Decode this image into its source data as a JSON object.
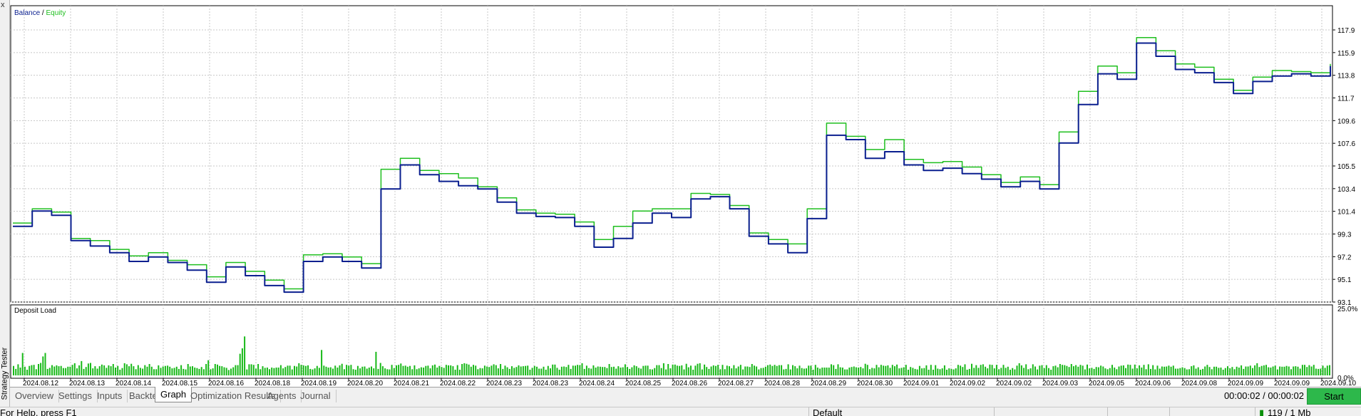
{
  "sidebar": {
    "close_glyph": "x",
    "title": "Strategy Tester"
  },
  "tabs": [
    {
      "label": "Overview",
      "active": false
    },
    {
      "label": "Settings",
      "active": false
    },
    {
      "label": "Inputs",
      "active": false
    },
    {
      "label": "Backtest",
      "active": false
    },
    {
      "label": "Graph",
      "active": true
    },
    {
      "label": "Optimization Results",
      "active": false
    },
    {
      "label": "Agents",
      "active": false
    },
    {
      "label": "Journal",
      "active": false
    }
  ],
  "timer": "00:00:02 / 00:00:02",
  "start_label": "Start",
  "status": {
    "help": "For Help, press F1",
    "profile": "Default",
    "traffic": "119 / 1 Mb"
  },
  "colors": {
    "balance": "#0a1f8f",
    "equity": "#1fbf1f",
    "deposit_bar": "#18b918",
    "grid": "#c8c8c8",
    "start_button": "#2db84b"
  },
  "chart_data": [
    {
      "type": "line",
      "legend": {
        "balance": "Balance",
        "separator": " / ",
        "equity": "Equity"
      },
      "legend_position": "top-left",
      "ylim": [
        93.1,
        117.9
      ],
      "ytick_labels": [
        "117.9",
        "115.9",
        "113.8",
        "111.7",
        "109.6",
        "107.6",
        "105.5",
        "103.4",
        "101.4",
        "99.3",
        "97.2",
        "95.1",
        "93.1"
      ],
      "grid": true,
      "series": [
        {
          "name": "Balance",
          "values": [
            100.0,
            101.4,
            101.0,
            98.7,
            98.2,
            97.6,
            96.8,
            97.2,
            96.7,
            96.0,
            94.9,
            96.3,
            95.5,
            94.6,
            94.0,
            96.8,
            97.2,
            96.8,
            96.2,
            103.4,
            105.6,
            104.7,
            104.1,
            103.7,
            103.4,
            102.2,
            101.2,
            100.9,
            100.8,
            100.0,
            98.1,
            98.9,
            100.3,
            101.2,
            100.8,
            102.5,
            102.7,
            101.6,
            99.1,
            98.4,
            97.6,
            100.7,
            108.3,
            107.9,
            106.2,
            106.8,
            105.6,
            105.1,
            105.3,
            104.8,
            104.3,
            103.6,
            104.1,
            103.4,
            107.6,
            111.1,
            113.9,
            113.4,
            116.7,
            115.5,
            114.3,
            114.0,
            113.1,
            112.1,
            113.2,
            113.7,
            113.9,
            113.7,
            114.6
          ]
        },
        {
          "name": "Equity",
          "values": [
            100.3,
            101.6,
            101.3,
            98.9,
            98.7,
            97.9,
            97.3,
            97.6,
            96.9,
            96.5,
            95.4,
            96.7,
            95.9,
            95.1,
            94.3,
            97.4,
            97.5,
            97.2,
            96.6,
            105.2,
            106.2,
            105.1,
            104.8,
            104.4,
            103.6,
            102.6,
            101.5,
            101.2,
            101.1,
            100.4,
            98.8,
            100.0,
            101.4,
            101.6,
            101.6,
            103.0,
            102.9,
            101.9,
            99.4,
            98.8,
            98.4,
            101.6,
            109.4,
            108.2,
            107.0,
            107.9,
            106.1,
            105.8,
            105.9,
            105.4,
            104.7,
            104.0,
            104.5,
            103.8,
            108.6,
            112.3,
            114.6,
            114.0,
            117.2,
            116.0,
            114.8,
            114.5,
            113.4,
            112.4,
            113.6,
            114.2,
            114.1,
            114.0,
            114.8
          ]
        }
      ]
    },
    {
      "type": "bar",
      "title": "Deposit Load",
      "ytick_labels": [
        "25.0%",
        "0.0%"
      ],
      "ylim": [
        0,
        25
      ],
      "x_labels": [
        "2024.08.12",
        "2024.08.13",
        "2024.08.14",
        "2024.08.15",
        "2024.08.16",
        "2024.08.18",
        "2024.08.19",
        "2024.08.20",
        "2024.08.21",
        "2024.08.22",
        "2024.08.23",
        "2024.08.23",
        "2024.08.24",
        "2024.08.25",
        "2024.08.26",
        "2024.08.27",
        "2024.08.28",
        "2024.08.29",
        "2024.08.30",
        "2024.09.01",
        "2024.09.02",
        "2024.09.02",
        "2024.09.03",
        "2024.09.05",
        "2024.09.06",
        "2024.09.08",
        "2024.09.09",
        "2024.09.09",
        "2024.09.10"
      ],
      "values": [
        3.5,
        2.4,
        4.1,
        2.9,
        8.3,
        3.2,
        2.1,
        3.5,
        3.8,
        3.9,
        2.3,
        4.2,
        4.6,
        7.0,
        8.3,
        2.4,
        2.8,
        3.8,
        3.3,
        3.7,
        3.4,
        3.5,
        2.7,
        2.7,
        3.2,
        3.2,
        3.9,
        4.5,
        2.6,
        3.7,
        5.3,
        2.4,
        3.1,
        4.4,
        4.6,
        2.6,
        3.4,
        2.5,
        3.4,
        4.0,
        3.7,
        2.8,
        3.7,
        3.4,
        4.2,
        2.9,
        3.5,
        2.1,
        2.7,
        4.5,
        4.1,
        3.4,
        4.3,
        3.4,
        2.3,
        3.8,
        2.8,
        2.5,
        3.8,
        3.2,
        4.2,
        3.2,
        2.3,
        2.3,
        3.7,
        2.8,
        3.3,
        3.5,
        3.6,
        3.2,
        2.6,
        2.8,
        3.2,
        2.4,
        3.8,
        2.4,
        2.2,
        4.2,
        3.3,
        3.4,
        2.9,
        2.7,
        2.4,
        3.1,
        2.3,
        4.2,
        5.6,
        2.3,
        2.6,
        4.2,
        4.0,
        3.5,
        3.4,
        3.0,
        2.8,
        2.0,
        2.5,
        3.0,
        3.8,
        3.8,
        8.0,
        10.0,
        14.4,
        2.2,
        4.1,
        4.1,
        3.9,
        2.5,
        4.2,
        2.3,
        3.4,
        2.8,
        2.9,
        2.3,
        2.9,
        2.7,
        2.9,
        2.9,
        3.8,
        2.6,
        3.1,
        3.6,
        3.6,
        2.2,
        3.5,
        3.3,
        4.5,
        3.9,
        3.7,
        3.5,
        3.7,
        2.4,
        2.2,
        2.6,
        3.5,
        2.8,
        9.4,
        3.6,
        3.2,
        2.9,
        3.0,
        2.5,
        3.6,
        2.9,
        3.7,
        4.3,
        2.3,
        3.9,
        3.6,
        3.9,
        2.3,
        2.1,
        3.5,
        2.6,
        3.2,
        3.3,
        2.5,
        2.9,
        3.3,
        2.6,
        8.7,
        2.4,
        4.6,
        3.4,
        2.6,
        2.3,
        2.2,
        3.9,
        2.7,
        3.7,
        3.9,
        4.4,
        3.5,
        3.6,
        3.2,
        3.5,
        2.3,
        3.7,
        2.3,
        2.6,
        3.0,
        2.9,
        3.5,
        3.6,
        2.6,
        3.7,
        4.0,
        2.9,
        3.5,
        3.1,
        2.8,
        3.9,
        3.7,
        3.7,
        3.4,
        2.1,
        3.8,
        2.1,
        4.2,
        4.5,
        4.3,
        4.0,
        3.2,
        3.9,
        3.6,
        2.3,
        2.7,
        2.6,
        3.6,
        3.3,
        3.1,
        3.6,
        4.1,
        3.8,
        2.6,
        4.2,
        2.4,
        3.6,
        3.0,
        2.4,
        3.4,
        2.8,
        3.1,
        3.7,
        3.3,
        3.4,
        3.5,
        3.6,
        2.1,
        2.8,
        3.5,
        3.2,
        2.5,
        2.5,
        3.2,
        2.1,
        3.5,
        2.6,
        4.0,
        4.0,
        2.8,
        2.1,
        3.2,
        3.3,
        3.1,
        3.9,
        2.4,
        3.6,
        3.6,
        3.9,
        3.8,
        4.5,
        2.4,
        3.6,
        2.7,
        2.5,
        3.7,
        2.9,
        3.3,
        3.2,
        3.1,
        3.1,
        2.7,
        4.2,
        3.1,
        3.2,
        2.5,
        3.4,
        2.9,
        3.0,
        4.1,
        3.1,
        2.4,
        3.0,
        3.7,
        3.4,
        2.8,
        2.5,
        3.5,
        3.6,
        3.6,
        2.3,
        2.2,
        2.7,
        3.8,
        3.8,
        2.7,
        4.5,
        2.2,
        4.2,
        2.6,
        4.0,
        4.0,
        3.6,
        3.5,
        3.7,
        2.2,
        4.3,
        3.0,
        3.6,
        2.1,
        3.6,
        4.3,
        4.5,
        2.2,
        4.0,
        3.1,
        2.4,
        3.3,
        3.7,
        3.5,
        3.9,
        2.3,
        3.9,
        2.3,
        3.6,
        3.4,
        2.6,
        3.8,
        2.6,
        3.3,
        3.9,
        2.2,
        3.3,
        3.3,
        3.1,
        4.2,
        3.6,
        3.3,
        2.2,
        2.7,
        2.8,
        3.2,
        3.8,
        4.0,
        3.5,
        3.9,
        3.5,
        3.8,
        3.8,
        2.2,
        2.4,
        4.1,
        2.2,
        3.8,
        3.4,
        2.6,
        3.6,
        2.7,
        2.5,
        2.6,
        3.6,
        3.6,
        2.1,
        3.9,
        2.9,
        2.5,
        2.9,
        2.9,
        2.9,
        2.9,
        4.1,
        3.8,
        2.4,
        4.1,
        3.0,
        2.9,
        2.2,
        2.2,
        2.9,
        3.1,
        3.3,
        3.0,
        2.9,
        3.1,
        2.6,
        4.3,
        3.9,
        2.3,
        2.8,
        2.6,
        3.9,
        3.0,
        3.9,
        3.6,
        3.5,
        3.7,
        2.8,
        3.9,
        3.4,
        4.0,
        2.6,
        2.8,
        3.0,
        3.9,
        2.1,
        3.1,
        2.8,
        2.4,
        2.2,
        3.5,
        2.6,
        2.7,
        3.7,
        2.1,
        3.9,
        2.1,
        3.8,
        2.5,
        2.3,
        2.6,
        3.7,
        2.1,
        2.6,
        2.4,
        2.2,
        2.6,
        3.9,
        3.6,
        3.1,
        4.1,
        2.1,
        2.4,
        4.3,
        2.8,
        3.8,
        2.8,
        3.9,
        4.1,
        3.2,
        2.6,
        4.0,
        3.9,
        2.6,
        3.9,
        2.3,
        2.8,
        3.9,
        2.8,
        3.2,
        2.1,
        2.7,
        2.2,
        3.6,
        4.5,
        3.7,
        2.8,
        4.1,
        2.3,
        2.6,
        4.1,
        3.3,
        2.2,
        3.6,
        3.8,
        2.7,
        3.8,
        2.7,
        2.1,
        3.4,
        3.6,
        3.0,
        4.2,
        3.9,
        3.8,
        3.5,
        3.1,
        4.2,
        3.4,
        3.8,
        3.2,
        3.9,
        3.6,
        2.2,
        4.0,
        2.6,
        2.8,
        2.4,
        3.1,
        3.0,
        3.6,
        3.3,
        2.6,
        2.3,
        2.7,
        3.9,
        2.9,
        2.3,
        3.3,
        3.6,
        3.7,
        2.7,
        4.0,
        3.9,
        2.5,
        4.0,
        2.6,
        3.7,
        2.9,
        3.9,
        2.3,
        4.1,
        2.4,
        3.8,
        2.2,
        3.6,
        2.5,
        3.3,
        3.2,
        3.3,
        3.6,
        3.2,
        3.6,
        2.5,
        2.5,
        2.7,
        3.0,
        2.7,
        2.2,
        2.3,
        3.4,
        3.7,
        2.5,
        3.0,
        2.1,
        2.4,
        3.3,
        3.9,
        3.1,
        2.3,
        3.2,
        3.2,
        2.8,
        2.9,
        2.1,
        2.7,
        3.4,
        2.6,
        3.1,
        2.3,
        3.2,
        2.9,
        3.7,
        2.4,
        3.3,
        3.3,
        3.6,
        2.7,
        3.7,
        4.5,
        3.1,
        3.5,
        3.7,
        3.9,
        3.0,
        2.9,
        3.3,
        3.6,
        2.2,
        3.3,
        3.2,
        3.2,
        3.5,
        3.3,
        2.3,
        3.3,
        3.4,
        3.2,
        2.5,
        3.9,
        3.9,
        3.1,
        3.8,
        3.3,
        3.9,
        2.5,
        2.4,
        2.5,
        3.6,
        2.8,
        3.6,
        3.8
      ]
    }
  ]
}
